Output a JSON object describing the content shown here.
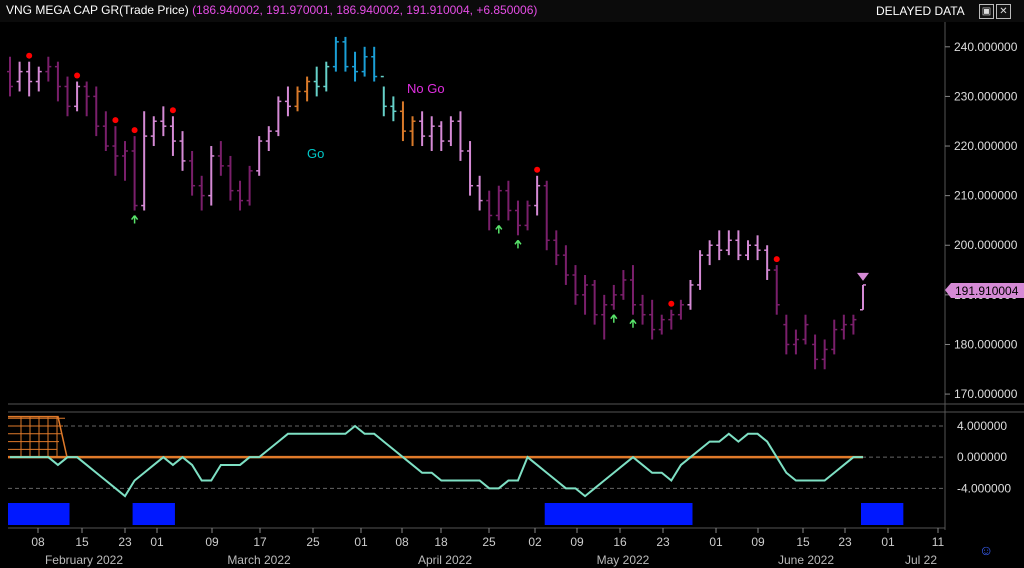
{
  "header": {
    "symbol": "VNG MEGA CAP GR",
    "price_field": "(Trade Price)",
    "values": "(186.940002, 191.970001, 186.940002, 191.910004, +6.850006)",
    "delayed_label": "DELAYED DATA",
    "restore_icon": "window-restore-icon",
    "close_icon": "close-icon"
  },
  "colors": {
    "background": "#000000",
    "go_strong": "#1b9fd6",
    "go_weak": "#66d1c9",
    "nogo_strong": "#7a1f6b",
    "nogo_weak": "#d58ad5",
    "neutral": "#d97a2a",
    "oscillator": "#7ee0c4",
    "zero_line": "#e07a2a",
    "volume_bar": "#0018ff",
    "price_tag": "#d58ad5",
    "dot": "#ff0000",
    "arrow": "#58e36a"
  },
  "annotations": {
    "go": "Go",
    "nogo": "No Go"
  },
  "price_tag": "191.910004",
  "footer_icon": "smiley-icon",
  "chart_data": [
    {
      "type": "candlestick",
      "title": "VNG MEGA CAP GR(Trade Price)",
      "ylim": [
        168,
        245
      ],
      "y_ticks": [
        "240.000000",
        "230.000000",
        "220.000000",
        "210.000000",
        "200.000000",
        "190.000000",
        "180.000000",
        "170.000000"
      ],
      "x_ticks": [
        "08",
        "15",
        "23",
        "01",
        "09",
        "17",
        "25",
        "01",
        "08",
        "18",
        "25",
        "02",
        "09",
        "16",
        "23",
        "01",
        "09",
        "15",
        "23",
        "01",
        "11"
      ],
      "month_labels": [
        "February 2022",
        "March 2022",
        "April 2022",
        "May 2022",
        "June 2022",
        "Jul 22"
      ],
      "bars": [
        [
          235,
          238,
          230,
          232,
          "nogo_strong"
        ],
        [
          233,
          237,
          231,
          235,
          "nogo_weak"
        ],
        [
          235,
          237,
          230,
          233,
          "nogo_weak"
        ],
        [
          233,
          236,
          231,
          235,
          "nogo_weak"
        ],
        [
          235,
          238,
          233,
          236,
          "nogo_strong"
        ],
        [
          236,
          237,
          229,
          232,
          "nogo_strong"
        ],
        [
          232,
          234,
          226,
          228,
          "nogo_strong"
        ],
        [
          228,
          233,
          227,
          232,
          "nogo_weak"
        ],
        [
          232,
          233,
          226,
          230,
          "nogo_strong"
        ],
        [
          230,
          232,
          222,
          224,
          "nogo_strong"
        ],
        [
          224,
          227,
          219,
          220,
          "nogo_strong"
        ],
        [
          220,
          224,
          214,
          218,
          "nogo_strong"
        ],
        [
          218,
          221,
          213,
          219,
          "nogo_strong"
        ],
        [
          219,
          222,
          207,
          208,
          "nogo_strong"
        ],
        [
          208,
          227,
          207,
          222,
          "nogo_weak"
        ],
        [
          222,
          226,
          220,
          225,
          "nogo_weak"
        ],
        [
          225,
          228,
          222,
          224,
          "nogo_weak"
        ],
        [
          224,
          226,
          218,
          221,
          "nogo_weak"
        ],
        [
          221,
          223,
          215,
          217,
          "nogo_weak"
        ],
        [
          217,
          219,
          210,
          212,
          "nogo_strong"
        ],
        [
          212,
          214,
          207,
          210,
          "nogo_strong"
        ],
        [
          210,
          220,
          208,
          218,
          "nogo_weak"
        ],
        [
          218,
          221,
          214,
          216,
          "nogo_strong"
        ],
        [
          216,
          218,
          209,
          211,
          "nogo_strong"
        ],
        [
          211,
          213,
          207,
          209,
          "nogo_strong"
        ],
        [
          209,
          216,
          208,
          215,
          "nogo_strong"
        ],
        [
          215,
          222,
          214,
          221,
          "nogo_weak"
        ],
        [
          221,
          224,
          219,
          223,
          "nogo_weak"
        ],
        [
          223,
          230,
          222,
          229,
          "nogo_weak"
        ],
        [
          229,
          232,
          226,
          228,
          "nogo_weak"
        ],
        [
          228,
          232,
          227,
          231,
          "neutral"
        ],
        [
          231,
          234,
          229,
          233,
          "neutral"
        ],
        [
          233,
          236,
          230,
          232,
          "go_weak"
        ],
        [
          232,
          237,
          231,
          236,
          "go_weak"
        ],
        [
          236,
          242,
          235,
          241,
          "go_strong"
        ],
        [
          241,
          242,
          235,
          236,
          "go_strong"
        ],
        [
          236,
          239,
          233,
          235,
          "go_strong"
        ],
        [
          235,
          240,
          234,
          238,
          "go_strong"
        ],
        [
          238,
          240,
          233,
          234,
          "go_strong"
        ],
        [
          234,
          232,
          226,
          228,
          "go_weak"
        ],
        [
          228,
          230,
          225,
          227,
          "go_weak"
        ],
        [
          227,
          229,
          221,
          223,
          "neutral"
        ],
        [
          223,
          226,
          220,
          225,
          "neutral"
        ],
        [
          225,
          227,
          220,
          222,
          "nogo_weak"
        ],
        [
          222,
          226,
          219,
          224,
          "nogo_weak"
        ],
        [
          224,
          225,
          219,
          221,
          "nogo_weak"
        ],
        [
          221,
          226,
          220,
          225,
          "nogo_weak"
        ],
        [
          225,
          227,
          217,
          219,
          "nogo_weak"
        ],
        [
          219,
          221,
          210,
          212,
          "nogo_weak"
        ],
        [
          212,
          214,
          207,
          209,
          "nogo_weak"
        ],
        [
          209,
          211,
          203,
          206,
          "nogo_strong"
        ],
        [
          206,
          212,
          205,
          211,
          "nogo_strong"
        ],
        [
          211,
          213,
          205,
          207,
          "nogo_strong"
        ],
        [
          207,
          209,
          202,
          204,
          "nogo_strong"
        ],
        [
          204,
          209,
          203,
          208,
          "nogo_strong"
        ],
        [
          208,
          214,
          206,
          212,
          "nogo_weak"
        ],
        [
          212,
          213,
          199,
          201,
          "nogo_strong"
        ],
        [
          201,
          203,
          196,
          198,
          "nogo_strong"
        ],
        [
          198,
          200,
          192,
          194,
          "nogo_strong"
        ],
        [
          194,
          196,
          188,
          190,
          "nogo_strong"
        ],
        [
          190,
          194,
          186,
          192,
          "nogo_strong"
        ],
        [
          192,
          193,
          184,
          186,
          "nogo_strong"
        ],
        [
          186,
          190,
          181,
          188,
          "nogo_strong"
        ],
        [
          188,
          192,
          187,
          190,
          "nogo_strong"
        ],
        [
          190,
          195,
          189,
          193,
          "nogo_strong"
        ],
        [
          193,
          196,
          186,
          188,
          "nogo_strong"
        ],
        [
          188,
          190,
          184,
          186,
          "nogo_strong"
        ],
        [
          186,
          189,
          181,
          183,
          "nogo_strong"
        ],
        [
          183,
          186,
          182,
          185,
          "nogo_strong"
        ],
        [
          185,
          187,
          183,
          186,
          "nogo_strong"
        ],
        [
          186,
          189,
          185,
          188,
          "nogo_strong"
        ],
        [
          188,
          193,
          187,
          192,
          "nogo_weak"
        ],
        [
          192,
          199,
          191,
          198,
          "nogo_weak"
        ],
        [
          198,
          201,
          196,
          200,
          "nogo_weak"
        ],
        [
          200,
          203,
          197,
          199,
          "nogo_weak"
        ],
        [
          199,
          203,
          198,
          201,
          "nogo_weak"
        ],
        [
          201,
          203,
          197,
          198,
          "nogo_weak"
        ],
        [
          198,
          201,
          197,
          200,
          "nogo_weak"
        ],
        [
          200,
          202,
          197,
          199,
          "nogo_weak"
        ],
        [
          199,
          200,
          193,
          195,
          "nogo_weak"
        ],
        [
          195,
          196,
          186,
          188,
          "nogo_strong"
        ],
        [
          184,
          186,
          178,
          180,
          "nogo_strong"
        ],
        [
          180,
          183,
          178,
          181,
          "nogo_strong"
        ],
        [
          181,
          186,
          180,
          184,
          "nogo_strong"
        ],
        [
          180,
          182,
          175,
          177,
          "nogo_strong"
        ],
        [
          177,
          181,
          175,
          179,
          "nogo_strong"
        ],
        [
          179,
          185,
          178,
          183,
          "nogo_strong"
        ],
        [
          183,
          186,
          181,
          184,
          "nogo_strong"
        ],
        [
          184,
          186,
          182,
          185,
          "nogo_strong"
        ],
        [
          187,
          192,
          187,
          192,
          "nogo_weak"
        ]
      ],
      "dots": [
        2,
        7,
        11,
        13,
        17,
        55,
        69,
        80
      ],
      "up_arrows": [
        13,
        51,
        53,
        63,
        65
      ],
      "current_price": 191.910004
    },
    {
      "type": "line",
      "ylim": [
        -5.5,
        5.8
      ],
      "y_ticks": [
        "4.000000",
        "0.000000",
        "-4.000000"
      ],
      "oscillator": [
        0,
        0,
        0,
        0,
        0,
        -1,
        0,
        0,
        -1,
        -2,
        -3,
        -4,
        -5,
        -3,
        -2,
        -1,
        0,
        -1,
        0,
        -1,
        -3,
        -3,
        -1,
        -1,
        -1,
        0,
        0,
        1,
        2,
        3,
        3,
        3,
        3,
        3,
        3,
        3,
        4,
        3,
        3,
        2,
        1,
        0,
        -1,
        -2,
        -2,
        -3,
        -3,
        -3,
        -3,
        -3,
        -4,
        -4,
        -3,
        -3,
        0,
        -1,
        -2,
        -3,
        -4,
        -4,
        -5,
        -4,
        -3,
        -2,
        -1,
        0,
        -1,
        -2,
        -2,
        -3,
        -1,
        0,
        1,
        2,
        2,
        3,
        2,
        3,
        3,
        2,
        0,
        -2,
        -3,
        -3,
        -3,
        -3,
        -2,
        -1,
        0,
        0
      ]
    },
    {
      "type": "bar",
      "regions": [
        [
          0,
          6
        ],
        [
          13,
          17
        ],
        [
          56,
          71
        ],
        [
          89,
          93
        ]
      ]
    }
  ]
}
